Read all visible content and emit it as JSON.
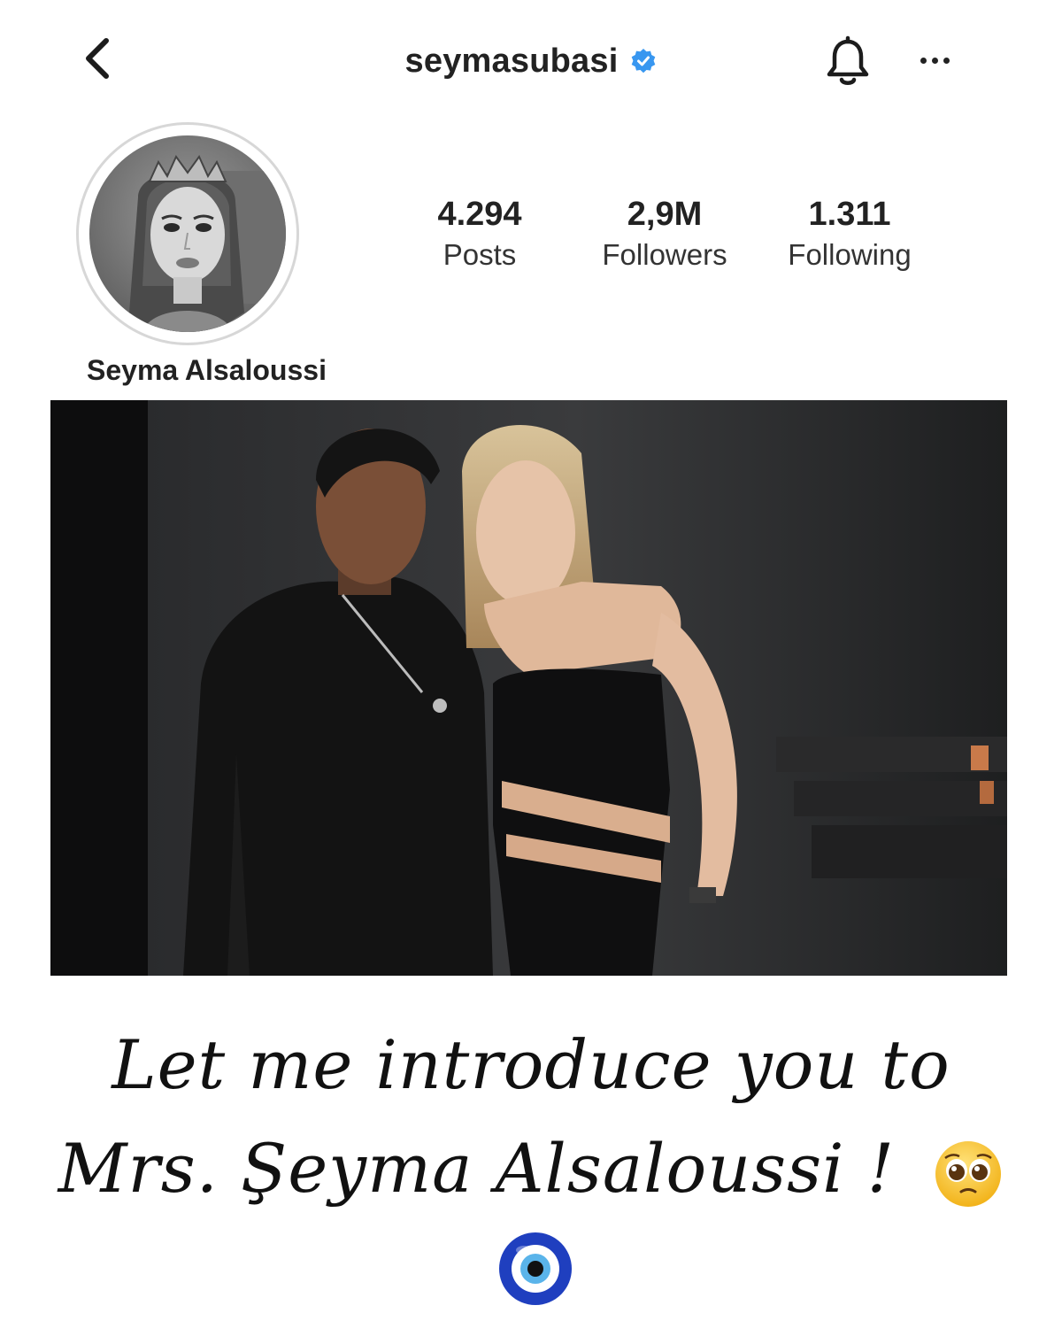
{
  "header": {
    "username": "seymasubasi",
    "verified": true,
    "icons": [
      "back-chevron-icon",
      "verified-badge-icon",
      "bell-icon",
      "more-dots-icon"
    ]
  },
  "profile": {
    "display_name": "Seyma Alsaloussi",
    "stats": [
      {
        "value": "4.294",
        "label": "Posts"
      },
      {
        "value": "2,9M",
        "label": "Followers"
      },
      {
        "value": "1.311",
        "label": "Following"
      }
    ]
  },
  "caption": {
    "line1": "Let me introduce you to",
    "line2": "Mrs. Şeyma Alsaloussi !",
    "emojis": [
      "pleading-face-emoji",
      "evil-eye-nazar-emoji"
    ]
  },
  "colors": {
    "verified_blue": "#3897f0",
    "text_dark": "#222222",
    "photo_bg": "#1a1a1b",
    "nazar_blue": "#1f3fbf"
  }
}
